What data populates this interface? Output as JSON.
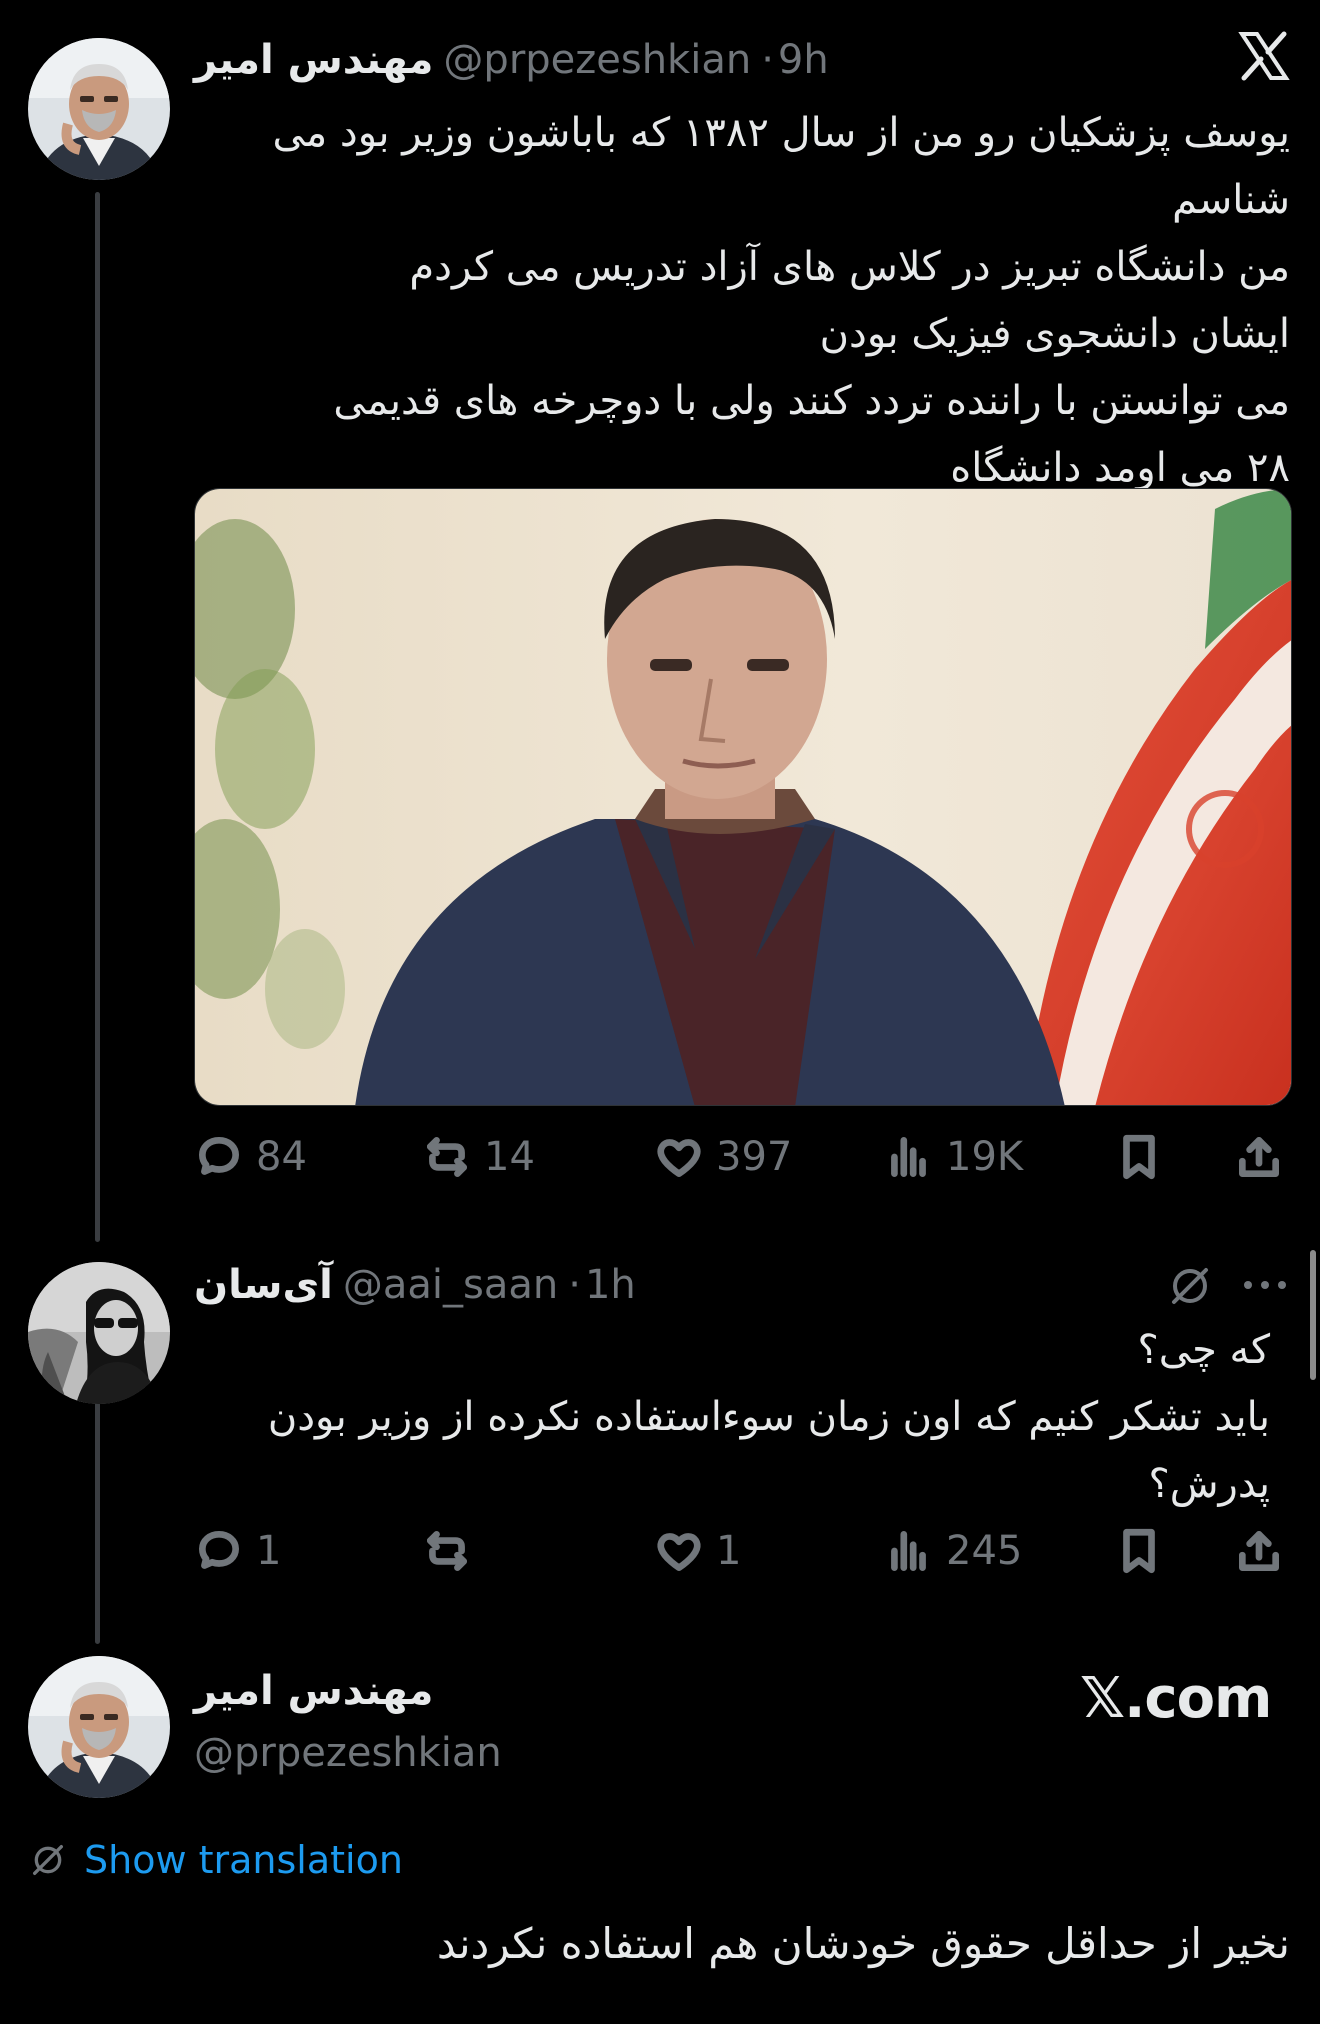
{
  "tweet1": {
    "name": "مهندس امیر",
    "handle": "@prpezeshkian",
    "time": "9h",
    "lines": [
      "یوسف پزشکیان رو من از سال ۱۳۸۲ که باباشون وزیر بود می",
      "شناسم",
      "من دانشگاه تبریز در کلاس های آزاد تدریس می کردم",
      "ایشان دانشجوی فیزیک بودن",
      "می توانستن با راننده تردد کنند ولی با دوچرخه های قدیمی",
      "۲۸ می اومد دانشگاه"
    ],
    "stats": {
      "replies": "84",
      "reposts": "14",
      "likes": "397",
      "views": "19K"
    }
  },
  "tweet2": {
    "name": "آی‌سان",
    "handle": "@aai_saan",
    "time": "1h",
    "lines": [
      "که چی؟",
      "باید تشکر کنیم که اون زمان سوءاستفاده نکرده از وزیر بودن",
      "پدرش؟"
    ],
    "stats": {
      "replies": "1",
      "reposts": "",
      "likes": "1",
      "views": "245"
    }
  },
  "tweet3": {
    "name": "مهندس امیر",
    "handle": "@prpezeshkian",
    "brand": "𝕏.com",
    "show_translation": "Show translation",
    "text": "نخیر از حداقل حقوق خودشان هم استفاده نکردند"
  },
  "icons": {
    "x_logo": "x-logo-icon",
    "reply": "reply-icon",
    "repost": "repost-icon",
    "like": "heart-icon",
    "views": "views-icon",
    "bookmark": "bookmark-icon",
    "share": "share-icon",
    "grok": "grok-icon",
    "more": "more-icon"
  },
  "colors": {
    "background": "#000000",
    "text": "#e7e9ea",
    "muted": "#71767b",
    "link": "#1d9bf0"
  }
}
